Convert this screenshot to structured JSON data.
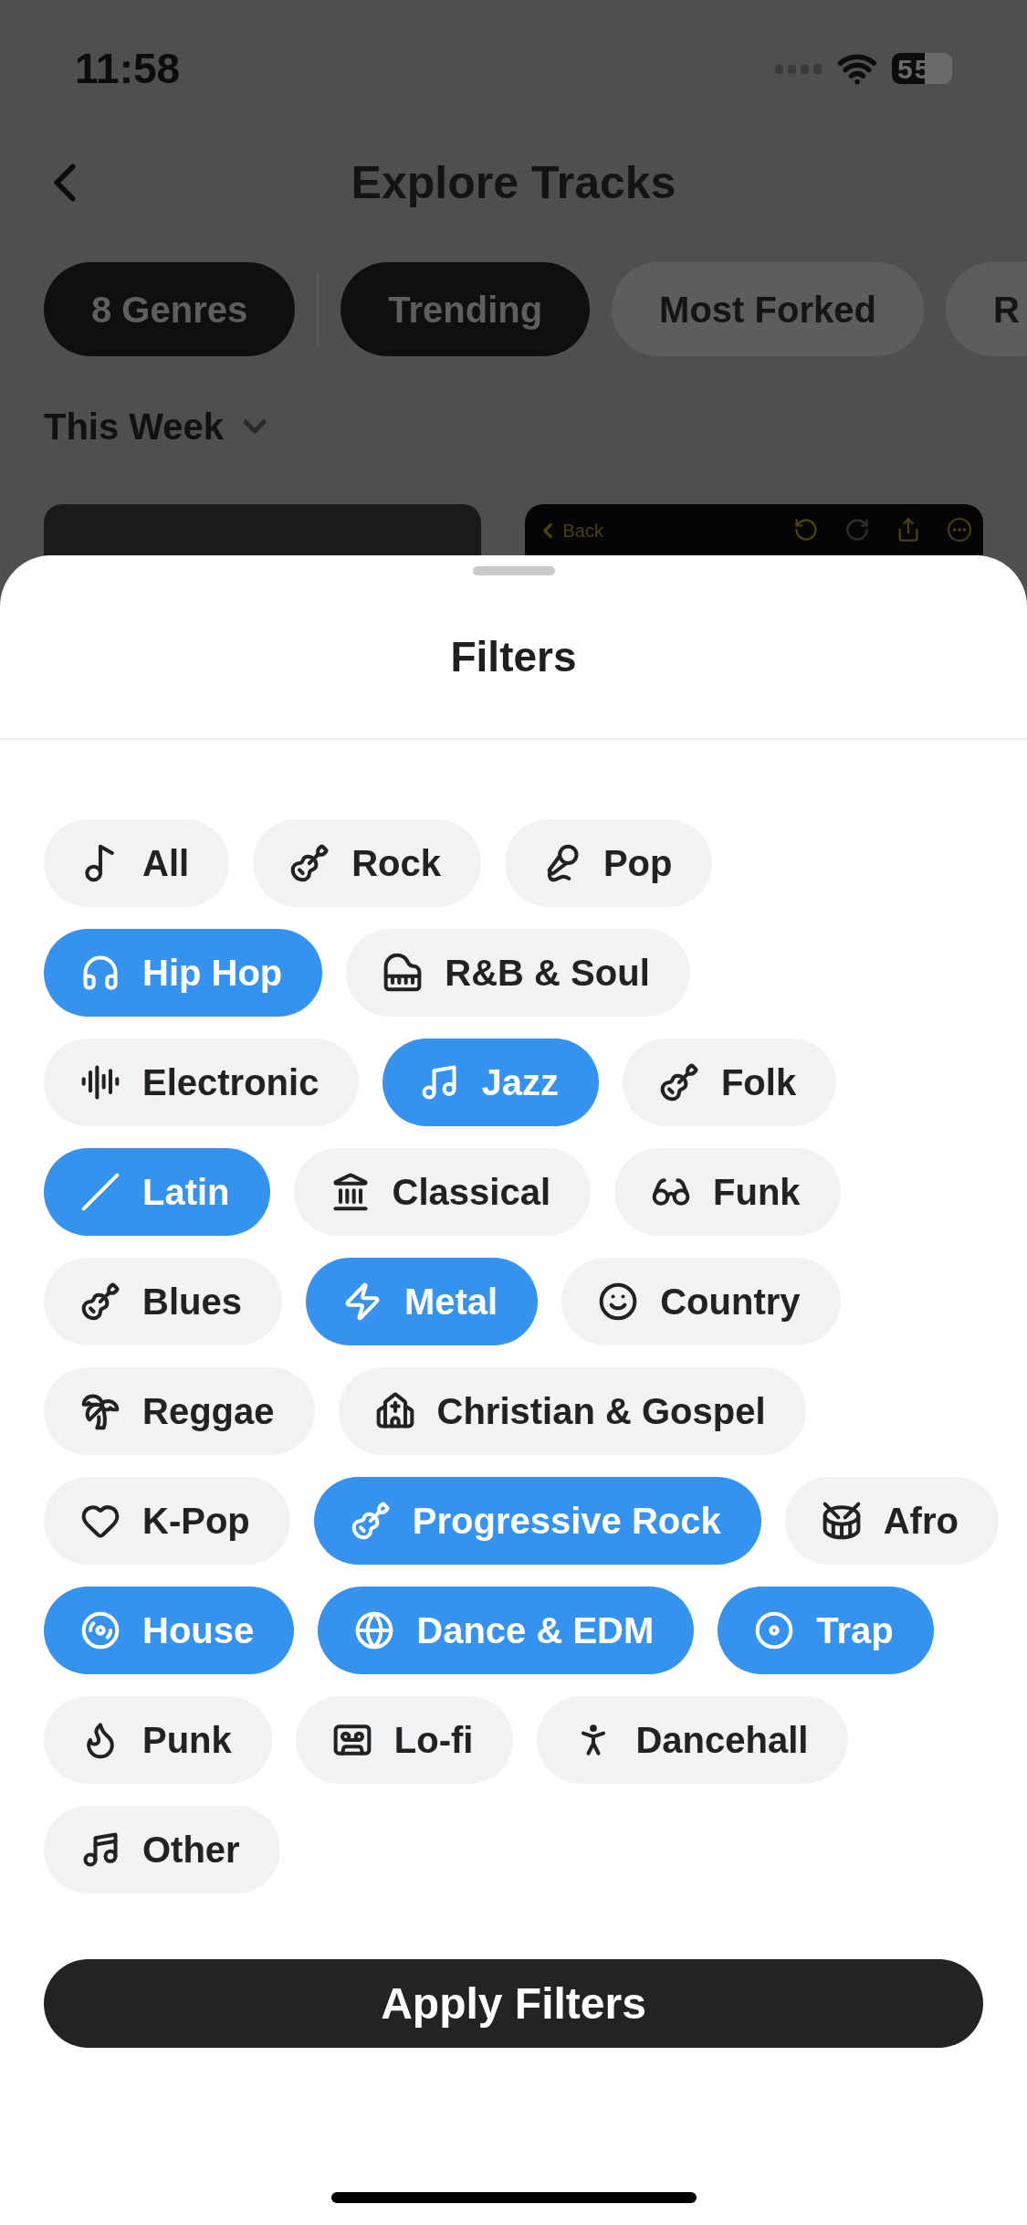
{
  "status_bar": {
    "time": "11:58",
    "battery": "55"
  },
  "header": {
    "title": "Explore Tracks"
  },
  "filter_pills": [
    {
      "label": "8 Genres",
      "selected": true
    },
    {
      "label": "Trending",
      "selected": true
    },
    {
      "label": "Most Forked",
      "selected": false
    },
    {
      "label": "R",
      "selected": false
    }
  ],
  "period": {
    "label": "This Week"
  },
  "preview_cards": [
    {
      "kind": "photo"
    },
    {
      "kind": "screenshot",
      "back_label": "Back"
    }
  ],
  "sheet": {
    "title": "Filters",
    "genres": [
      {
        "label": "All",
        "selected": false
      },
      {
        "label": "Rock",
        "selected": false
      },
      {
        "label": "Pop",
        "selected": false
      },
      {
        "label": "Hip Hop",
        "selected": true
      },
      {
        "label": "R&B & Soul",
        "selected": false
      },
      {
        "label": "Electronic",
        "selected": false
      },
      {
        "label": "Jazz",
        "selected": true
      },
      {
        "label": "Folk",
        "selected": false
      },
      {
        "label": "Latin",
        "selected": true
      },
      {
        "label": "Classical",
        "selected": false
      },
      {
        "label": "Funk",
        "selected": false
      },
      {
        "label": "Blues",
        "selected": false
      },
      {
        "label": "Metal",
        "selected": true
      },
      {
        "label": "Country",
        "selected": false
      },
      {
        "label": "Reggae",
        "selected": false
      },
      {
        "label": "Christian & Gospel",
        "selected": false
      },
      {
        "label": "K-Pop",
        "selected": false
      },
      {
        "label": "Progressive Rock",
        "selected": true
      },
      {
        "label": "Afro",
        "selected": false
      },
      {
        "label": "House",
        "selected": true
      },
      {
        "label": "Dance & EDM",
        "selected": true
      },
      {
        "label": "Trap",
        "selected": true
      },
      {
        "label": "Punk",
        "selected": false
      },
      {
        "label": "Lo-fi",
        "selected": false
      },
      {
        "label": "Dancehall",
        "selected": false
      },
      {
        "label": "Other",
        "selected": false
      }
    ],
    "apply_button": "Apply Filters"
  }
}
